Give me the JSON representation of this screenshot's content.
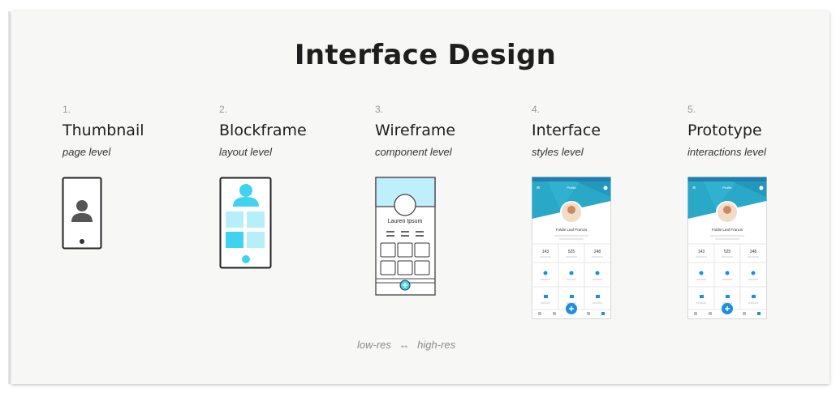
{
  "title": "Interface Design",
  "steps": [
    {
      "num": "1.",
      "name": "Thumbnail",
      "level": "page level"
    },
    {
      "num": "2.",
      "name": "Blockframe",
      "level": "layout level"
    },
    {
      "num": "3.",
      "name": "Wireframe",
      "level": "component level"
    },
    {
      "num": "4.",
      "name": "Interface",
      "level": "styles level"
    },
    {
      "num": "5.",
      "name": "Prototype",
      "level": "interactions level"
    }
  ],
  "wireframe": {
    "name": "Lauren Ipsum"
  },
  "mock": {
    "header": "Profile",
    "name": "Foldie Leaf Francis",
    "stats": [
      {
        "value": "143"
      },
      {
        "value": "525"
      },
      {
        "value": "248"
      }
    ],
    "icon_color": "#1d8fe0",
    "header_color": "#2aa8c8"
  },
  "footer": {
    "low": "low-res",
    "arrow": "↔",
    "high": "high-res"
  },
  "colors": {
    "accent": "#3fd3f0",
    "accent_light": "#b6eefa",
    "text": "#1e1e1e"
  }
}
